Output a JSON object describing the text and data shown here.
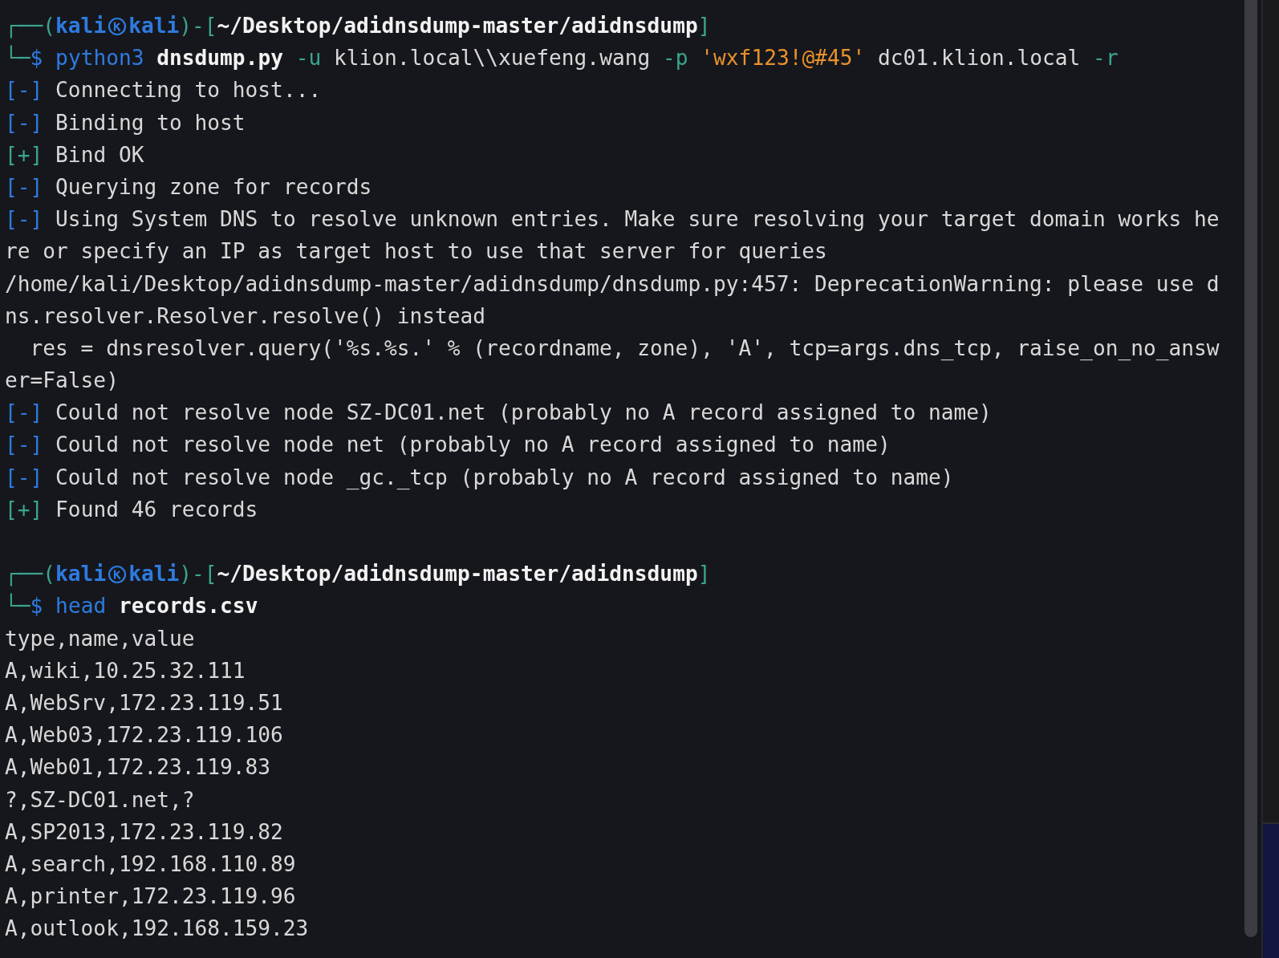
{
  "terminal": {
    "lines": [
      {
        "kind": "prompt_top",
        "segments": [
          {
            "kind": "frame",
            "text": "┌──("
          },
          {
            "kind": "user",
            "text": "kali"
          },
          {
            "kind": "at_icon"
          },
          {
            "kind": "user",
            "text": "kali"
          },
          {
            "kind": "frame",
            "text": ")-["
          },
          {
            "kind": "path",
            "text": "~/Desktop/adidnsdump-master/adidnsdump"
          },
          {
            "kind": "frame",
            "text": "]"
          }
        ]
      },
      {
        "kind": "prompt_command",
        "segments": [
          {
            "kind": "frame",
            "text": "└─"
          },
          {
            "kind": "symbol",
            "text": "$"
          },
          {
            "kind": "program",
            "text": "python3"
          },
          {
            "kind": "script",
            "text": "dnsdump.py"
          },
          {
            "kind": "flag",
            "text": "-u"
          },
          {
            "kind": "arg",
            "text": "klion.local\\\\xuefeng.wang"
          },
          {
            "kind": "flag",
            "text": "-p"
          },
          {
            "kind": "string",
            "text": "'wxf123!@#45'"
          },
          {
            "kind": "arg",
            "text": "dc01.klion.local"
          },
          {
            "kind": "flag",
            "text": "-r"
          }
        ]
      },
      {
        "kind": "status",
        "marker": "[-]",
        "color": "#2d7be0",
        "text": "Connecting to host..."
      },
      {
        "kind": "status",
        "marker": "[-]",
        "color": "#2d7be0",
        "text": "Binding to host"
      },
      {
        "kind": "status",
        "marker": "[+]",
        "color": "#3aa58f",
        "text": "Bind OK"
      },
      {
        "kind": "status",
        "marker": "[-]",
        "color": "#2d7be0",
        "text": "Querying zone for records"
      },
      {
        "kind": "status",
        "marker": "[-]",
        "color": "#2d7be0",
        "text": "Using System DNS to resolve unknown entries. Make sure resolving your target domain works he"
      },
      {
        "kind": "plain",
        "text": "re or specify an IP as target host to use that server for queries"
      },
      {
        "kind": "plain",
        "text": "/home/kali/Desktop/adidnsdump-master/adidnsdump/dnsdump.py:457: DeprecationWarning: please use d"
      },
      {
        "kind": "plain",
        "text": "ns.resolver.Resolver.resolve() instead"
      },
      {
        "kind": "plain",
        "text": "  res = dnsresolver.query('%s.%s.' % (recordname, zone), 'A', tcp=args.dns_tcp, raise_on_no_answ"
      },
      {
        "kind": "plain",
        "text": "er=False)"
      },
      {
        "kind": "status",
        "marker": "[-]",
        "color": "#2d7be0",
        "text": "Could not resolve node SZ-DC01.net (probably no A record assigned to name)"
      },
      {
        "kind": "status",
        "marker": "[-]",
        "color": "#2d7be0",
        "text": "Could not resolve node net (probably no A record assigned to name)"
      },
      {
        "kind": "status",
        "marker": "[-]",
        "color": "#2d7be0",
        "text": "Could not resolve node _gc._tcp (probably no A record assigned to name)"
      },
      {
        "kind": "status",
        "marker": "[+]",
        "color": "#3aa58f",
        "text": "Found 46 records"
      },
      {
        "kind": "blank"
      },
      {
        "kind": "prompt_top",
        "segments": [
          {
            "kind": "frame",
            "text": "┌──("
          },
          {
            "kind": "user",
            "text": "kali"
          },
          {
            "kind": "at_icon"
          },
          {
            "kind": "user",
            "text": "kali"
          },
          {
            "kind": "frame",
            "text": ")-["
          },
          {
            "kind": "path",
            "text": "~/Desktop/adidnsdump-master/adidnsdump"
          },
          {
            "kind": "frame",
            "text": "]"
          }
        ]
      },
      {
        "kind": "prompt_command",
        "segments": [
          {
            "kind": "frame",
            "text": "└─"
          },
          {
            "kind": "symbol",
            "text": "$"
          },
          {
            "kind": "program",
            "text": "head"
          },
          {
            "kind": "script",
            "text": "records.csv"
          }
        ]
      },
      {
        "kind": "plain",
        "text": "type,name,value"
      },
      {
        "kind": "plain",
        "text": "A,wiki,10.25.32.111"
      },
      {
        "kind": "plain",
        "text": "A,WebSrv,172.23.119.51"
      },
      {
        "kind": "plain",
        "text": "A,Web03,172.23.119.106"
      },
      {
        "kind": "plain",
        "text": "A,Web01,172.23.119.83"
      },
      {
        "kind": "plain",
        "text": "?,SZ-DC01.net,?"
      },
      {
        "kind": "plain",
        "text": "A,SP2013,172.23.119.82"
      },
      {
        "kind": "plain",
        "text": "A,search,192.168.110.89"
      },
      {
        "kind": "plain",
        "text": "A,printer,172.23.119.96"
      },
      {
        "kind": "plain",
        "text": "A,outlook,192.168.159.23"
      }
    ]
  }
}
